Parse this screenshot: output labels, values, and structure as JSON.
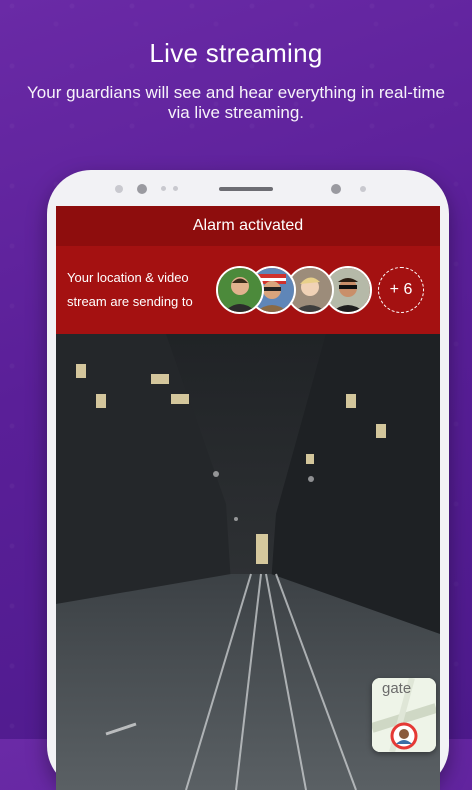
{
  "header": {
    "title": "Live streaming",
    "subtitle": "Your guardians will see and hear everything in real-time via live streaming."
  },
  "screen": {
    "alarm_title": "Alarm activated",
    "location_text": "Your location & video stream are sending to",
    "extra_guardians": "+ 6",
    "avatars": [
      "guardian-1",
      "guardian-2",
      "guardian-3",
      "guardian-4"
    ],
    "map_label": "gate"
  },
  "colors": {
    "background": "#5a1f98",
    "alarm_bar": "#8e0d0d",
    "guardian_bar": "#a41111"
  }
}
